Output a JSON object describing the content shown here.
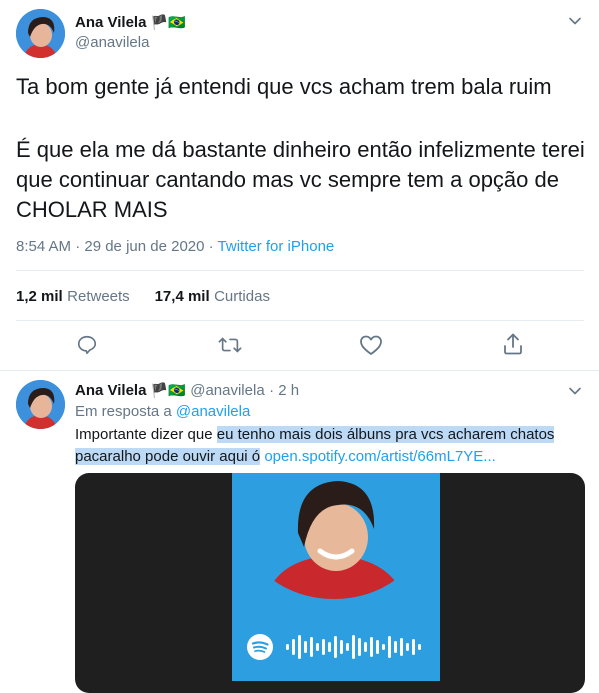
{
  "tweet": {
    "author_name": "Ana Vilela",
    "author_flags": "🏴🇧🇷",
    "author_handle": "@anavilela",
    "paragraph1": "Ta bom gente já entendi que vcs acham trem bala ruim",
    "paragraph2": "É que ela me dá bastante dinheiro então infelizmente terei que continuar cantando mas vc sempre tem a opção de CHOLAR MAIS",
    "time": "8:54 AM · 29 de jun de 2020 ·",
    "source": "Twitter for iPhone",
    "retweets_count": "1,2 mil",
    "retweets_label": "Retweets",
    "likes_count": "17,4 mil",
    "likes_label": "Curtidas"
  },
  "reply": {
    "author_name": "Ana Vilela",
    "author_flags": "🏴🇧🇷",
    "author_handle": "@anavilela",
    "age": "· 2 h",
    "in_reply_prefix": "Em resposta a",
    "in_reply_handle": "@anavilela",
    "text_plain": "Importante dizer que ",
    "text_hl1": "eu tenho mais dois álbuns pra vcs acharem chatos",
    "text_hl2": "pacaralho pode ouvir aqui ó",
    "link": "open.spotify.com/artist/66mL7YE..."
  },
  "colors": {
    "accent": "#1da1f2",
    "highlight": "#bcd9f5",
    "spotify_card": "#2d9fe0"
  },
  "icons": [
    "chevron-down-icon",
    "reply-icon",
    "retweet-icon",
    "like-icon",
    "share-icon",
    "spotify-icon"
  ]
}
